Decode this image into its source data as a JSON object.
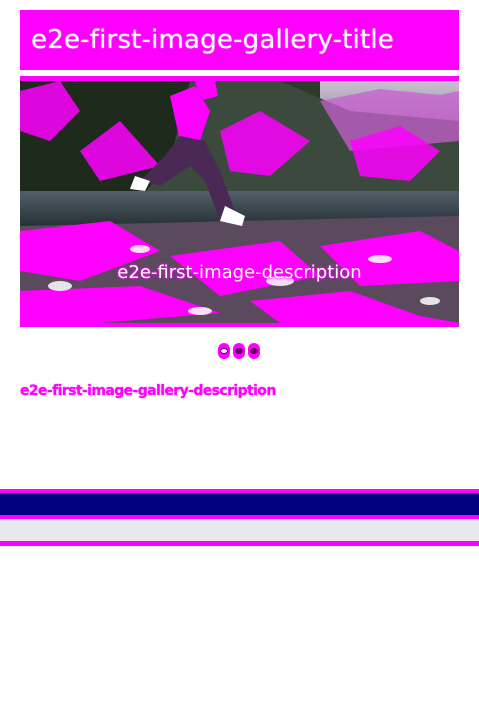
{
  "gallery": {
    "title": "e2e-first-image-gallery-title",
    "description": "e2e-first-image-gallery-description",
    "slides": [
      {
        "caption": "e2e-first-image-description",
        "image_subject": "person-jumping-by-mountain-lake"
      }
    ],
    "pagination": {
      "count": 3,
      "active_index": 0
    }
  },
  "colors": {
    "accent": "#ff00ff",
    "navy_band": "#000080",
    "grey_band": "#e8e8ee",
    "dot_dark": "#5a0060"
  }
}
